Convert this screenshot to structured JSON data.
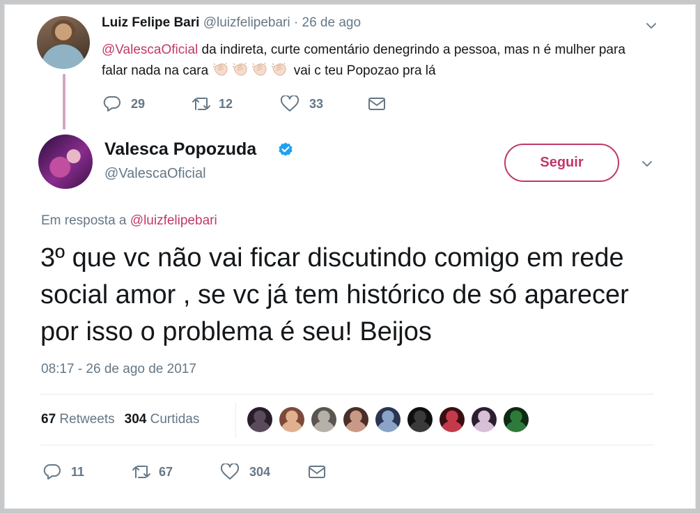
{
  "parent_tweet": {
    "name": "Luiz Felipe Bari",
    "handle": "@luizfelipebari",
    "separator": "·",
    "time": "26 de ago",
    "mention": "@ValescaOficial",
    "text_1": " da indireta, curte comentário denegrindo a pessoa, mas n é mulher para falar nada na cara ",
    "text_2": " vai c teu Popozao pra lá",
    "clap_count": 4,
    "replies": "29",
    "retweets": "12",
    "likes": "33"
  },
  "main_tweet": {
    "name": "Valesca Popozuda",
    "handle": "@ValescaOficial",
    "follow_label": "Seguir",
    "reply_prefix": "Em resposta a ",
    "reply_to": "@luizfelipebari",
    "text": "3º que vc não vai ficar discutindo comigo em rede social amor , se vc já tem histórico de só aparecer por isso o problema é seu! Beijos",
    "timestamp": "08:17 - 26 de ago de 2017",
    "retweet_count": "67",
    "retweet_label": "Retweets",
    "like_count": "304",
    "like_label": "Curtidas",
    "replies": "11",
    "retweets": "67",
    "likes": "304"
  },
  "likers": [
    {
      "colors": [
        "#5a4a5c",
        "#2a1d2b"
      ]
    },
    {
      "colors": [
        "#e0b090",
        "#7d4a3a"
      ]
    },
    {
      "colors": [
        "#b5b0a8",
        "#5a5550"
      ]
    },
    {
      "colors": [
        "#c89a86",
        "#4a2f28"
      ]
    },
    {
      "colors": [
        "#8aa4c8",
        "#2a3550"
      ]
    },
    {
      "colors": [
        "#3a3a3a",
        "#0f0f0f"
      ]
    },
    {
      "colors": [
        "#c43a4a",
        "#3a0f14"
      ]
    },
    {
      "colors": [
        "#d7c0d8",
        "#2a2030"
      ]
    },
    {
      "colors": [
        "#2f7a3a",
        "#0e2a12"
      ]
    }
  ],
  "colors": {
    "accent": "#c0386a",
    "text": "#14171a",
    "muted": "#657786",
    "thread_line": "#d2a6c0",
    "verified": "#1da1f2"
  }
}
